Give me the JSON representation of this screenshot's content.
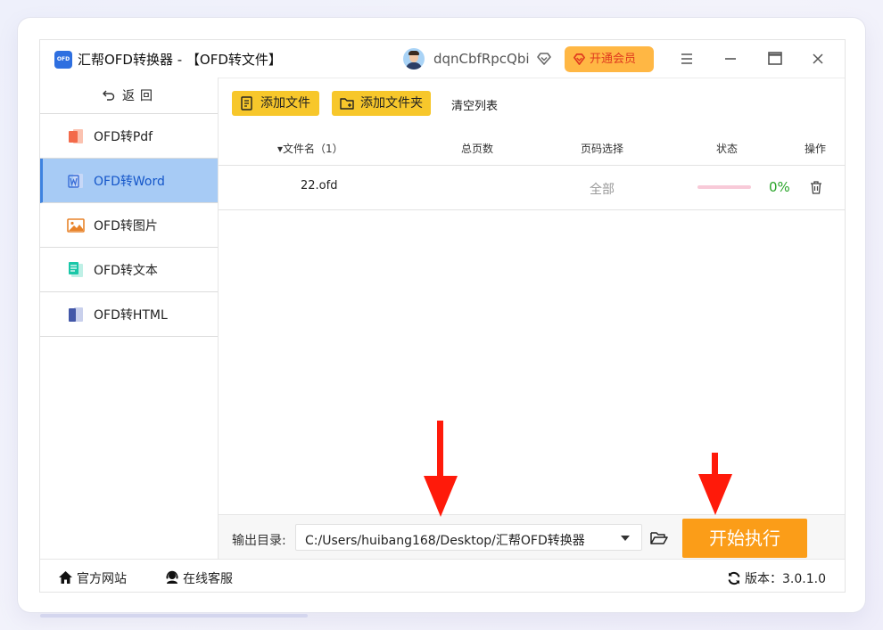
{
  "app": {
    "logo_text": "OFD",
    "title": "汇帮OFD转换器 - 【OFD转文件】",
    "username": "dqnCbfRpcQbi",
    "vip_label": "开通会员"
  },
  "sidebar": {
    "back_label": "返回",
    "items": [
      {
        "label": "OFD转Pdf",
        "icon": "pdf-icon",
        "color": "#f36a4a"
      },
      {
        "label": "OFD转Word",
        "icon": "word-icon",
        "color": "#3b6fd8"
      },
      {
        "label": "OFD转图片",
        "icon": "image-icon",
        "color": "#e8832a"
      },
      {
        "label": "OFD转文本",
        "icon": "text-file-icon",
        "color": "#19c7a8"
      },
      {
        "label": "OFD转HTML",
        "icon": "html-icon",
        "color": "#4257a8"
      }
    ],
    "active_index": 1
  },
  "toolbar": {
    "add_file": "添加文件",
    "add_folder": "添加文件夹",
    "clear_list": "清空列表"
  },
  "table": {
    "headers": {
      "name": "▾文件名（1）",
      "pages": "总页数",
      "range": "页码选择",
      "status": "状态",
      "action": "操作"
    },
    "rows": [
      {
        "name": "22.ofd",
        "pages": "",
        "range": "全部",
        "progress": 0,
        "progress_text": "0%"
      }
    ]
  },
  "output": {
    "label": "输出目录:",
    "path": "C:/Users/huibang168/Desktop/汇帮OFD转换器",
    "start_label": "开始执行"
  },
  "statusbar": {
    "site_label": "官方网站",
    "service_label": "在线客服",
    "version_label": "版本：3.0.1.0"
  },
  "colors": {
    "accent_yellow": "#f7c72b",
    "start_orange": "#fb9d18",
    "active_nav": "#a7cbf5",
    "arrow_red": "#ff1a0a",
    "progress_green": "#28a428"
  }
}
